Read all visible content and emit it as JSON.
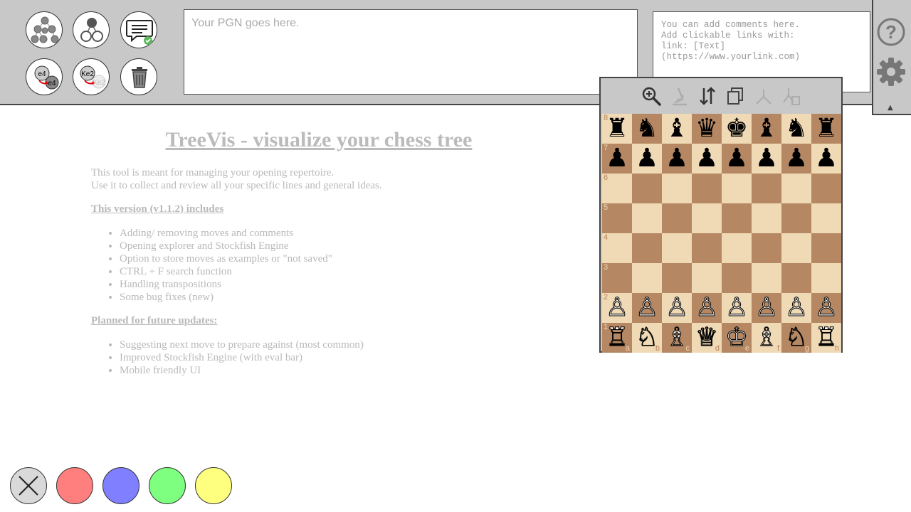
{
  "pgn": {
    "placeholder": "Your PGN goes here."
  },
  "comment": {
    "placeholder": "You can add comments here.\n Add clickable links with:\nlink: [Text](https://www.yourlink.com)"
  },
  "toolbar_buttons": [
    {
      "name": "tree-view-button",
      "icon": "tree-graph-icon"
    },
    {
      "name": "branch-view-button",
      "icon": "small-tree-icon"
    },
    {
      "name": "comments-button",
      "icon": "comment-bubble-check-icon"
    },
    {
      "name": "move-button",
      "icon": "move-arrow-icon",
      "from_label": "e4",
      "to_label": "e4"
    },
    {
      "name": "transposition-button",
      "icon": "transposition-icon",
      "from_label": "Ke2",
      "to_label": "Ke2"
    },
    {
      "name": "delete-button",
      "icon": "trash-icon"
    }
  ],
  "right_icons": {
    "help": "help-icon",
    "settings": "gear-icon",
    "collapse": "▲"
  },
  "content": {
    "title": "TreeVis - visualize your chess tree",
    "intro_lines": [
      "This tool is meant for managing your opening repertoire.",
      "Use it to collect and review all your specific lines and general ideas."
    ],
    "version_heading": "This version (v1.1.2) includes",
    "version_items": [
      "Adding/ removing moves and comments",
      "Opening explorer and Stockfish Engine",
      "Option to store moves as examples or \"not saved\"",
      "CTRL + F search function",
      "Handling transpositions",
      "Some bug fixes (new)"
    ],
    "planned_heading": "Planned for future updates:",
    "planned_items": [
      "Suggesting next move to prepare against (most common)",
      "Improved Stockfish Engine (with eval bar)",
      "Mobile friendly UI"
    ]
  },
  "board_toolbar": [
    {
      "name": "zoom-button",
      "icon": "magnifier-plus-icon",
      "enabled": true
    },
    {
      "name": "engine-button",
      "icon": "microscope-icon",
      "enabled": false
    },
    {
      "name": "flip-board-button",
      "icon": "flip-arrows-icon",
      "enabled": true
    },
    {
      "name": "copy-button",
      "icon": "copy-icon",
      "enabled": true
    },
    {
      "name": "branch-button",
      "icon": "branch-icon",
      "enabled": false
    },
    {
      "name": "delete-branch-button",
      "icon": "branch-delete-icon",
      "enabled": false
    }
  ],
  "board": {
    "ranks": [
      "8",
      "7",
      "6",
      "5",
      "4",
      "3",
      "2",
      "1"
    ],
    "files": [
      "a",
      "b",
      "c",
      "d",
      "e",
      "f",
      "g",
      "h"
    ],
    "position": [
      [
        "♜",
        "♞",
        "♝",
        "♛",
        "♚",
        "♝",
        "♞",
        "♜"
      ],
      [
        "♟",
        "♟",
        "♟",
        "♟",
        "♟",
        "♟",
        "♟",
        "♟"
      ],
      [
        "",
        "",
        "",
        "",
        "",
        "",
        "",
        ""
      ],
      [
        "",
        "",
        "",
        "",
        "",
        "",
        "",
        ""
      ],
      [
        "",
        "",
        "",
        "",
        "",
        "",
        "",
        ""
      ],
      [
        "",
        "",
        "",
        "",
        "",
        "",
        "",
        ""
      ],
      [
        "♙",
        "♙",
        "♙",
        "♙",
        "♙",
        "♙",
        "♙",
        "♙"
      ],
      [
        "♖",
        "♘",
        "♗",
        "♕",
        "♔",
        "♗",
        "♘",
        "♖"
      ]
    ],
    "light_color": "#f0d9b5",
    "dark_color": "#b58863"
  },
  "color_buttons": [
    {
      "name": "clear-color-button",
      "color": "#d9d9d9",
      "icon": "x-icon"
    },
    {
      "name": "red-color-button",
      "color": "#ff7f7f"
    },
    {
      "name": "blue-color-button",
      "color": "#7f7fff"
    },
    {
      "name": "green-color-button",
      "color": "#7fff7f"
    },
    {
      "name": "yellow-color-button",
      "color": "#ffff7f"
    }
  ]
}
